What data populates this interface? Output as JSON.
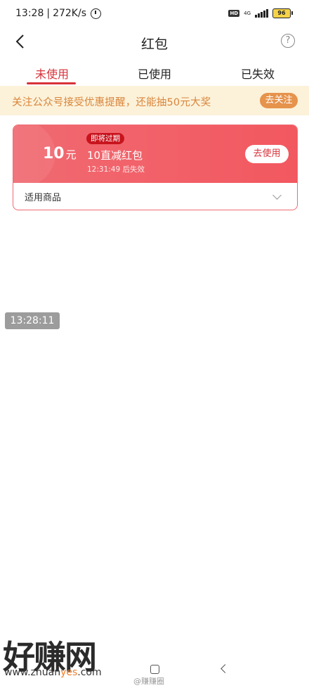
{
  "status_bar": {
    "time": "13:28",
    "speed": "272K/s",
    "hd": "HD",
    "network": "4G",
    "battery": "96"
  },
  "header": {
    "title": "红包",
    "help": "?"
  },
  "tabs": [
    {
      "label": "未使用"
    },
    {
      "label": "已使用"
    },
    {
      "label": "已失效"
    }
  ],
  "notice": {
    "text": "关注公众号接受优惠提醒，还能抽50元大奖",
    "button": "去关注"
  },
  "coupon": {
    "amount": "10",
    "unit": "元",
    "badge": "即将过期",
    "name": "10直减红包",
    "countdown": "12:31:49 后失效",
    "use_button": "去使用",
    "applicable_label": "适用商品"
  },
  "overlay_timestamp": "13:28:11",
  "watermark": {
    "logo": "好赚网",
    "url_pre": "www.zhuan",
    "url_hl": "yes",
    "url_post": ".com",
    "weibo": "@赚赚圈"
  },
  "colors": {
    "accent": "#d8323a",
    "coupon": "#f06a71",
    "notice_bg": "#fcf2da",
    "notice_text": "#d9853b"
  }
}
